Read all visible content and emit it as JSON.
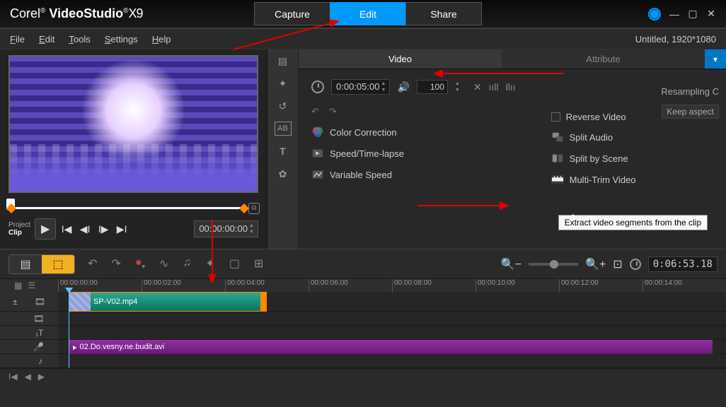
{
  "app": {
    "logo_light": "Corel",
    "logo_reg": "®",
    "logo_bold": "VideoStudio",
    "logo_x9": "X9"
  },
  "modes": {
    "capture": "Capture",
    "edit": "Edit",
    "share": "Share"
  },
  "menu": {
    "file": "File",
    "edit": "Edit",
    "tools": "Tools",
    "settings": "Settings",
    "help": "Help"
  },
  "doc": "Untitled, 1920*1080",
  "preview": {
    "project_label": "Project",
    "clip_label": "Clip",
    "timecode": "00:00:00:00"
  },
  "opt_tabs": {
    "video": "Video",
    "attribute": "Attribute"
  },
  "opt_header": {
    "timecode": "0:00:05:00",
    "volume": "100"
  },
  "opts": {
    "reverse": "Reverse Video",
    "color": "Color Correction",
    "speed": "Speed/Time-lapse",
    "varspeed": "Variable Speed",
    "split_audio": "Split Audio",
    "split_scene": "Split by Scene",
    "multi_trim": "Multi-Trim Video",
    "resampling": "Resampling C",
    "keep_aspect": "Keep aspect"
  },
  "tooltip": "Extract video segments from the clip",
  "timeline": {
    "ticks": [
      "00:00:00:00",
      "00:00:02:00",
      "00:00:04:00",
      "00:00:06:00",
      "00:00:08:00",
      "00:00:10:00",
      "00:00:12:00",
      "00:00:14:00"
    ],
    "duration": "0:06:53.18",
    "clip_video": "SP-V02.mp4",
    "clip_audio": "02.Do.vesny.ne.budit.avi"
  }
}
